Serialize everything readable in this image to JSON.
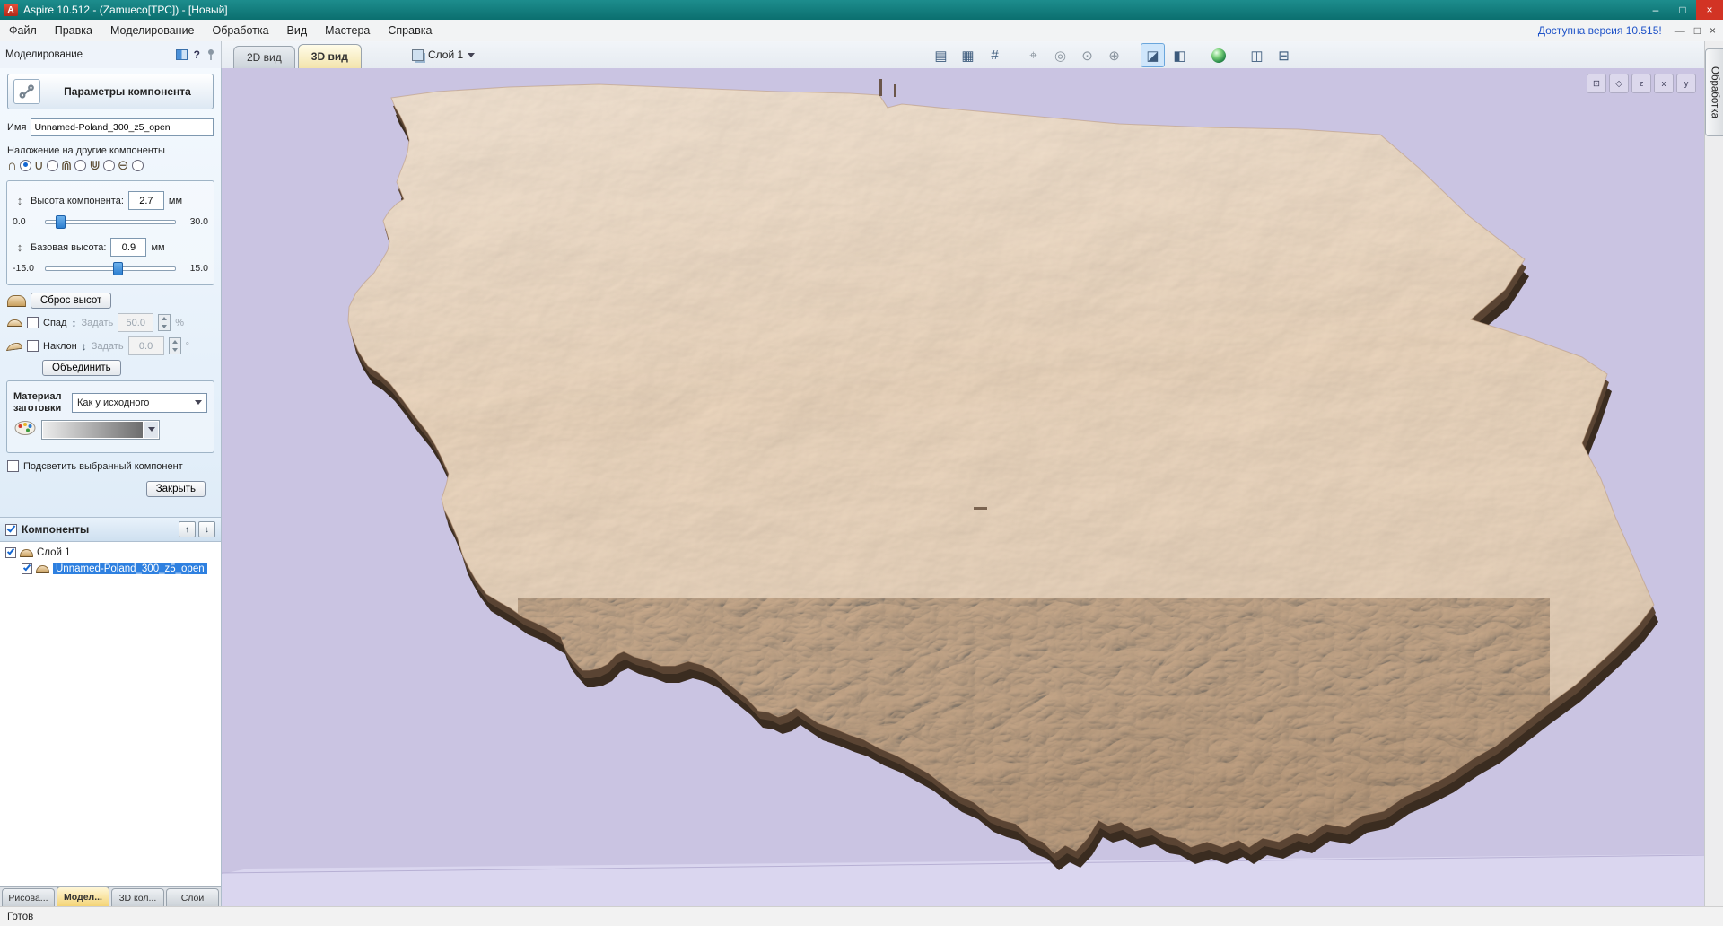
{
  "titlebar": {
    "title": "Aspire 10.512 - (Zamueco[ТРС]) - [Новый]",
    "app_icon": "A",
    "minimize": "–",
    "maximize": "□",
    "close": "×"
  },
  "menubar": {
    "items": [
      "Файл",
      "Правка",
      "Моделирование",
      "Обработка",
      "Вид",
      "Мастера",
      "Справка"
    ],
    "update_link": "Доступна версия 10.515!",
    "mdi_minimize": "—",
    "mdi_restore": "□",
    "mdi_close": "×"
  },
  "panel_strip": {
    "title": "Моделирование",
    "help_icon": "?"
  },
  "view_tabs": {
    "tab_2d": "2D вид",
    "tab_3d": "3D вид"
  },
  "layer_selector": {
    "value": "Слой 1"
  },
  "toolbar_icons": {
    "snap_guides": "▤",
    "snap_grid": "▦",
    "grid_toggle": "#",
    "pan_view": "⌖",
    "zoom_window": "◎",
    "zoom_drag": "⊙",
    "zoom_extents": "⊕",
    "shading_toggle": "◪",
    "wireframe_toggle": "◧",
    "single_view": "◫",
    "split_view": "⊟"
  },
  "view_buttons": {
    "iso": "⊡",
    "plan": "◇",
    "z": "z",
    "x": "x",
    "y": "y"
  },
  "glyphs": {
    "updown": "↕"
  },
  "params": {
    "title": "Параметры компонента",
    "name_label": "Имя",
    "name_value": "Unnamed-Poland_300_z5_open",
    "combine_label": "Наложение на другие компоненты",
    "combine_modes": [
      "∩",
      "∪",
      "⋒",
      "⋓",
      "⊖"
    ],
    "height_label": "Высота компонента:",
    "height_value": "2.7",
    "height_unit": "мм",
    "height_min": "0.0",
    "height_max": "30.0",
    "base_label": "Базовая высота:",
    "base_value": "0.9",
    "base_unit": "мм",
    "base_min": "-15.0",
    "base_max": "15.0",
    "reset_button": "Сброс высот",
    "fade_label": "Спад",
    "set_label": "Задать",
    "fade_value": "50.0",
    "fade_unit": "%",
    "tilt_label": "Наклон",
    "tilt_value": "0.0",
    "tilt_unit": "°",
    "merge_button": "Объединить",
    "material_label": "Материал заготовки",
    "material_value": "Как у исходного",
    "highlight_label": "Подсветить выбранный компонент",
    "close_button": "Закрыть"
  },
  "components": {
    "header": "Компоненты",
    "up_icon": "↑",
    "down_icon": "↓",
    "rows": [
      {
        "label": "Слой 1"
      },
      {
        "label": "Unnamed-Poland_300_z5_open"
      }
    ]
  },
  "bottom_tabs": {
    "items": [
      "Рисова...",
      "Модел...",
      "3D кол...",
      "Слои"
    ]
  },
  "right_tab": {
    "label": "Обработка"
  },
  "statusbar": {
    "text": "Готов"
  },
  "colors": {
    "titlebar_teal": "#0e7a7a",
    "view_background": "#cac4e2",
    "model_tan": "#e4c7ab",
    "model_side": "#433326",
    "selection_blue": "#2e80e0",
    "active_tab_yellow": "#f4d476"
  }
}
